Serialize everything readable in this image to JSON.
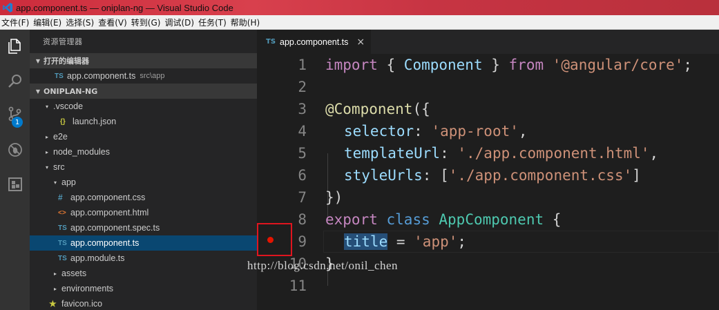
{
  "window": {
    "title": "app.component.ts — oniplan-ng — Visual Studio Code",
    "accent_color": "#cc2c3c"
  },
  "menubar": {
    "items": [
      "文件(F)",
      "编辑(E)",
      "选择(S)",
      "查看(V)",
      "转到(G)",
      "调试(D)",
      "任务(T)",
      "帮助(H)"
    ]
  },
  "activitybar": {
    "icons": [
      "files-icon",
      "search-icon",
      "source-control-icon",
      "debug-icon",
      "extensions-icon"
    ],
    "scm_badge": "1"
  },
  "sidebar": {
    "title": "资源管理器",
    "open_editors_header": "打开的编辑器",
    "open_editors": [
      {
        "icon": "TS",
        "name": "app.component.ts",
        "description": "src\\app"
      }
    ],
    "project_header": "ONIPLAN-NG",
    "tree": [
      {
        "name": ".vscode",
        "icon": "",
        "twisty": "▾",
        "depth": 1
      },
      {
        "name": "launch.json",
        "icon": "{}",
        "twisty": "",
        "depth": 2
      },
      {
        "name": "e2e",
        "icon": "",
        "twisty": "▸",
        "depth": 1
      },
      {
        "name": "node_modules",
        "icon": "",
        "twisty": "▸",
        "depth": 1
      },
      {
        "name": "src",
        "icon": "",
        "twisty": "▾",
        "depth": 1
      },
      {
        "name": "app",
        "icon": "",
        "twisty": "▾",
        "depth": 2
      },
      {
        "name": "app.component.css",
        "icon": "#",
        "twisty": "",
        "depth": 3
      },
      {
        "name": "app.component.html",
        "icon": "<>",
        "twisty": "",
        "depth": 3
      },
      {
        "name": "app.component.spec.ts",
        "icon": "TS",
        "twisty": "",
        "depth": 3
      },
      {
        "name": "app.component.ts",
        "icon": "TS",
        "twisty": "",
        "depth": 3,
        "selected": true
      },
      {
        "name": "app.module.ts",
        "icon": "TS",
        "twisty": "",
        "depth": 3
      },
      {
        "name": "assets",
        "icon": "",
        "twisty": "▸",
        "depth": 2
      },
      {
        "name": "environments",
        "icon": "",
        "twisty": "▸",
        "depth": 2
      },
      {
        "name": "favicon.ico",
        "icon": "★",
        "twisty": "",
        "depth": 2
      }
    ]
  },
  "editor": {
    "tab": {
      "icon": "TS",
      "label": "app.component.ts",
      "close": "×"
    },
    "line_numbers": [
      "1",
      "2",
      "3",
      "4",
      "5",
      "6",
      "7",
      "8",
      "9",
      "10",
      "11"
    ],
    "breakpoint_line": 9,
    "code": {
      "l1": {
        "kw": "import",
        "p1": " { ",
        "cls": "Component",
        "p2": " } ",
        "kw2": "from",
        "sp": " ",
        "str": "'@angular/core'",
        "end": ";"
      },
      "l3": {
        "dec": "@Component",
        "p": "({"
      },
      "l4": {
        "prop": "selector",
        "p": ": ",
        "str": "'app-root'",
        "end": ","
      },
      "l5": {
        "prop": "templateUrl",
        "p": ": ",
        "str": "'./app.component.html'",
        "end": ","
      },
      "l6": {
        "prop": "styleUrls",
        "p": ": [",
        "str": "'./app.component.css'",
        "end": "]"
      },
      "l7": {
        "p": "})"
      },
      "l8": {
        "kw2": "export",
        "sp": " ",
        "kw": "class",
        "sp2": " ",
        "cls": "AppComponent",
        "end": " {"
      },
      "l9": {
        "prop": "title",
        "p": " = ",
        "str": "'app'",
        "end": ";"
      },
      "l10": {
        "p": "}"
      }
    }
  },
  "watermark": "http://blog.csdn.net/onil_chen"
}
